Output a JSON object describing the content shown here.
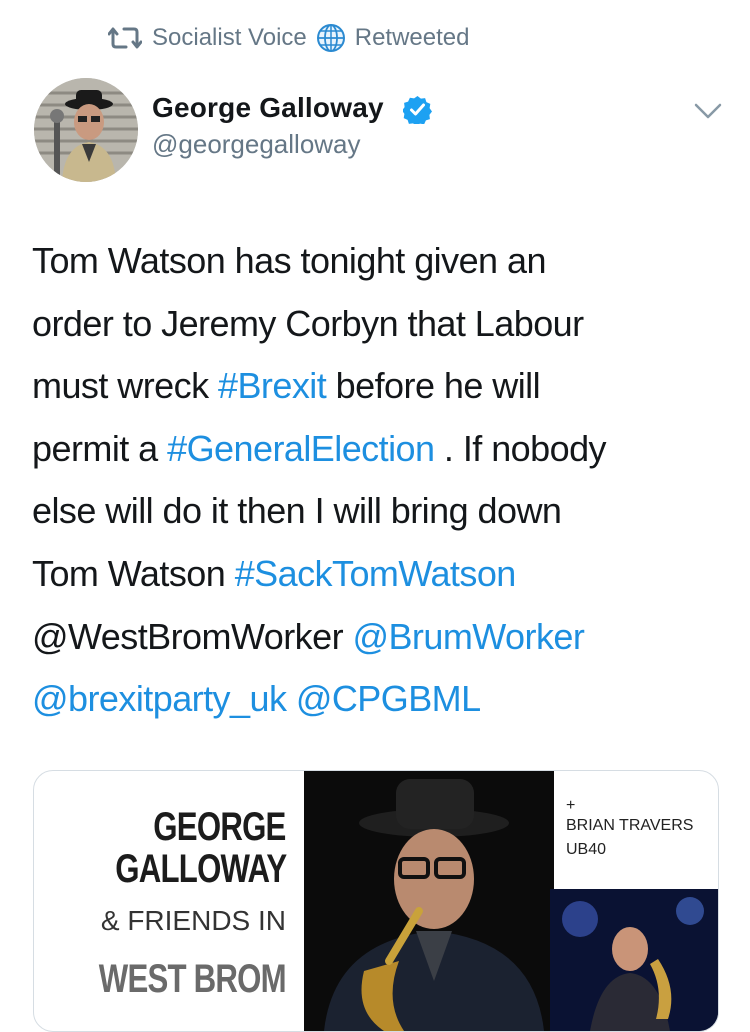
{
  "retweet_bar": {
    "retweeter": "Socialist Voice",
    "suffix": "Retweeted",
    "icons": [
      "retweet-icon",
      "globe-icon"
    ]
  },
  "author": {
    "name": "George Galloway",
    "handle": "@georgegalloway",
    "verified": true,
    "icons": [
      "verified-badge-icon",
      "chevron-down-icon"
    ]
  },
  "tweet": {
    "t1": "Tom Watson has tonight given an\norder to Jeremy Corbyn that Labour\nmust wreck ",
    "tag_brexit": "#Brexit",
    "t2": " before he will\npermit a ",
    "tag_election": "#GeneralElection",
    "t3": " . If nobody\nelse will do it then I will bring down\nTom Watson ",
    "tag_sack": "#SackTomWatson",
    "t4": "\n@WestBromWorker ",
    "mention_brum": "@BrumWorker",
    "t5": "\n",
    "mention_brexitparty": "@brexitparty_uk",
    "t6": " ",
    "mention_cpgbml": "@CPGBML"
  },
  "media": {
    "line1": "GEORGE",
    "line2": "GALLOWAY",
    "line3": "& FRIENDS IN",
    "line4": "WEST BROM",
    "plus": "+",
    "guest_name": "BRIAN TRAVERS",
    "guest_band": "UB40"
  },
  "colors": {
    "link": "#1d8fe0",
    "muted": "#657786",
    "verified": "#1da1f2",
    "text": "#14171a"
  }
}
